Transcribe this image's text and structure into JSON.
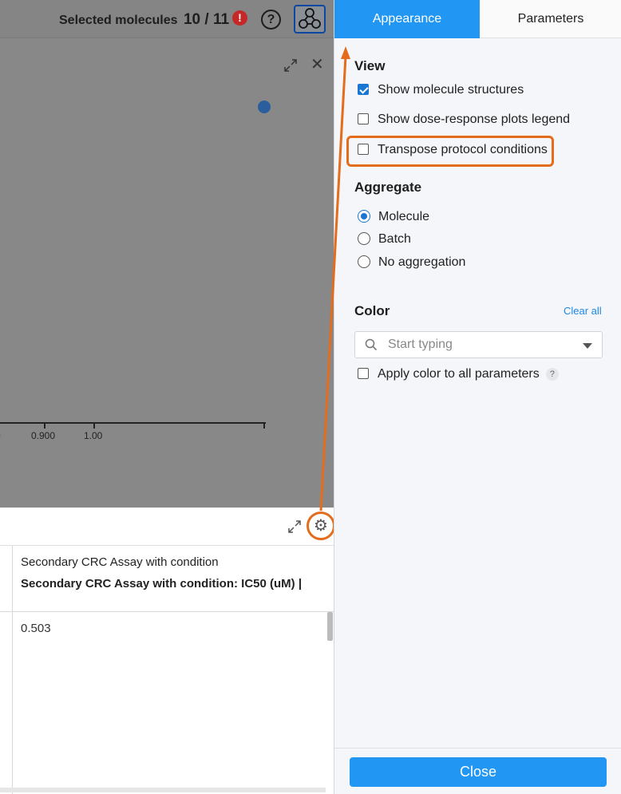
{
  "header": {
    "selected_label": "Selected molecules",
    "selected_count": "10 / 11",
    "error_icon": "!",
    "help_icon": "?"
  },
  "plot": {
    "x_ticks": [
      "0",
      "0.900",
      "1.00"
    ]
  },
  "table": {
    "column_title": "Secondary CRC Assay with condition",
    "column_subtitle": "Secondary CRC Assay with condition: IC50 (uM) |",
    "cell_value": "0.503"
  },
  "panel": {
    "tabs": [
      "Appearance",
      "Parameters"
    ],
    "active_tab": "Appearance",
    "view": {
      "title": "View",
      "options": [
        {
          "label": "Show molecule structures",
          "checked": true
        },
        {
          "label": "Show dose-response plots legend",
          "checked": false
        },
        {
          "label": "Transpose protocol conditions",
          "checked": false
        }
      ]
    },
    "aggregate": {
      "title": "Aggregate",
      "options": [
        {
          "label": "Molecule",
          "selected": true
        },
        {
          "label": "Batch",
          "selected": false
        },
        {
          "label": "No aggregation",
          "selected": false
        }
      ]
    },
    "color": {
      "title": "Color",
      "clear_all": "Clear all",
      "placeholder": "Start typing",
      "apply_all_label": "Apply color to all parameters",
      "apply_all_checked": false,
      "help": "?"
    },
    "close_label": "Close"
  },
  "colors": {
    "accent": "#2196f3",
    "annotation": "#e36c1d",
    "error": "#c62828"
  }
}
